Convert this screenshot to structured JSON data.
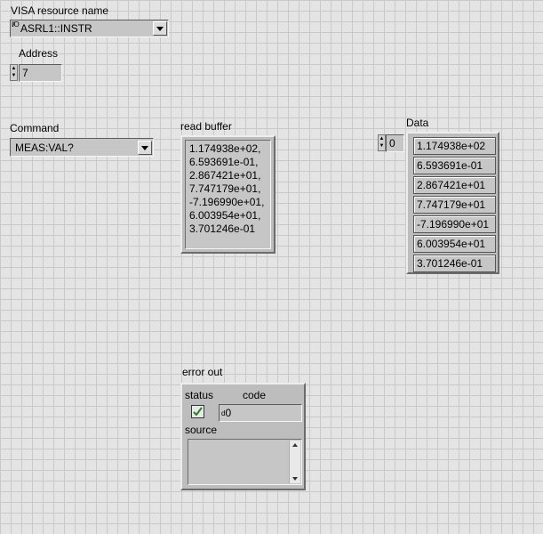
{
  "visa": {
    "label": "VISA resource name",
    "value": "ASRL1::INSTR",
    "io_glyph": "I/O"
  },
  "address": {
    "label": "Address",
    "value": "7"
  },
  "command": {
    "label": "Command",
    "value": "MEAS:VAL?"
  },
  "read_buffer": {
    "label": "read buffer",
    "text": "1.174938e+02,\n6.593691e-01,\n2.867421e+01,\n7.747179e+01,\n-7.196990e+01,\n6.003954e+01,\n3.701246e-01"
  },
  "data": {
    "label": "Data",
    "index": "0",
    "values": [
      "1.174938e+02",
      "6.593691e-01",
      "2.867421e+01",
      "7.747179e+01",
      "-7.196990e+01",
      "6.003954e+01",
      "3.701246e-01"
    ]
  },
  "error_out": {
    "label": "error out",
    "status_label": "status",
    "code_label": "code",
    "code_value": "0",
    "code_radix": "d",
    "source_label": "source",
    "source_value": "",
    "status_ok_color": "#1a8a1a"
  }
}
